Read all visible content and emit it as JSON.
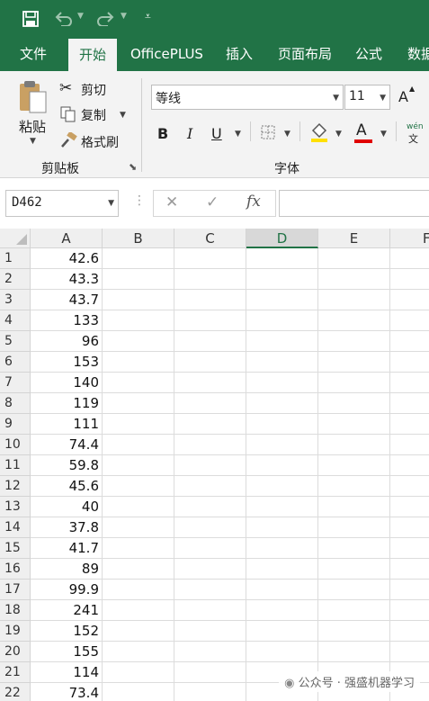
{
  "quick_access": {
    "save_icon": "save-icon",
    "undo_icon": "undo-icon",
    "redo_icon": "redo-icon",
    "customize_icon": "customize-qat-icon"
  },
  "tabs": [
    {
      "label": "文件"
    },
    {
      "label": "开始"
    },
    {
      "label": "OfficePLUS"
    },
    {
      "label": "插入"
    },
    {
      "label": "页面布局"
    },
    {
      "label": "公式"
    },
    {
      "label": "数据"
    }
  ],
  "clipboard": {
    "paste_label": "粘贴",
    "cut_label": "剪切",
    "copy_label": "复制",
    "format_painter_label": "格式刷",
    "group_label": "剪贴板"
  },
  "font": {
    "font_name": "等线",
    "font_size": "11",
    "bold": "B",
    "italic": "I",
    "underline": "U",
    "font_color_letter": "A",
    "grow_letter": "A",
    "phonetic_top": "wén",
    "phonetic_bottom": "文",
    "group_label": "字体",
    "font_color": "#e00000",
    "highlight_color": "#ffe000"
  },
  "formula_bar": {
    "name_box": "D462",
    "cancel": "✕",
    "confirm": "✓",
    "fx": "fx",
    "value": ""
  },
  "columns": [
    "A",
    "B",
    "C",
    "D",
    "E",
    "F"
  ],
  "selected_column": "D",
  "rows": [
    {
      "num": "1",
      "a": "42.6"
    },
    {
      "num": "2",
      "a": "43.3"
    },
    {
      "num": "3",
      "a": "43.7"
    },
    {
      "num": "4",
      "a": "133"
    },
    {
      "num": "5",
      "a": "96"
    },
    {
      "num": "6",
      "a": "153"
    },
    {
      "num": "7",
      "a": "140"
    },
    {
      "num": "8",
      "a": "119"
    },
    {
      "num": "9",
      "a": "111"
    },
    {
      "num": "10",
      "a": "74.4"
    },
    {
      "num": "11",
      "a": "59.8"
    },
    {
      "num": "12",
      "a": "45.6"
    },
    {
      "num": "13",
      "a": "40"
    },
    {
      "num": "14",
      "a": "37.8"
    },
    {
      "num": "15",
      "a": "41.7"
    },
    {
      "num": "16",
      "a": "89"
    },
    {
      "num": "17",
      "a": "99.9"
    },
    {
      "num": "18",
      "a": "241"
    },
    {
      "num": "19",
      "a": "152"
    },
    {
      "num": "20",
      "a": "155"
    },
    {
      "num": "21",
      "a": "114"
    },
    {
      "num": "22",
      "a": "73.4"
    }
  ],
  "watermark": "公众号 · 强盛机器学习",
  "colors": {
    "brand": "#217346"
  }
}
